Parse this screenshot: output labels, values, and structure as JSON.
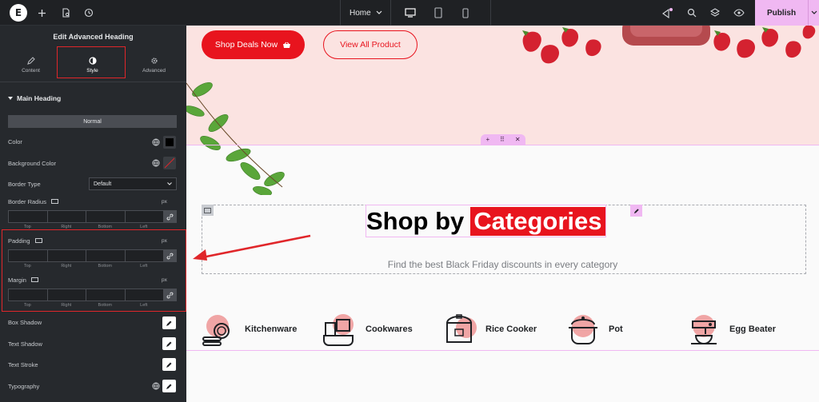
{
  "topbar": {
    "logo": "E",
    "home_label": "Home",
    "publish_label": "Publish"
  },
  "panel": {
    "title": "Edit Advanced Heading",
    "tabs": [
      {
        "label": "Content",
        "icon": "pencil-icon"
      },
      {
        "label": "Style",
        "icon": "contrast-icon"
      },
      {
        "label": "Advanced",
        "icon": "gear-icon"
      }
    ],
    "section_title": "Main Heading",
    "state_label": "Normal",
    "color_label": "Color",
    "bg_color_label": "Background Color",
    "border_type_label": "Border Type",
    "border_type_value": "Default",
    "border_radius_label": "Border Radius",
    "padding_label": "Padding",
    "margin_label": "Margin",
    "unit": "px",
    "dim_labels": [
      "Top",
      "Right",
      "Bottom",
      "Left"
    ],
    "box_shadow_label": "Box Shadow",
    "text_shadow_label": "Text Shadow",
    "text_stroke_label": "Text Stroke",
    "typography_label": "Typography"
  },
  "canvas": {
    "btn_deals": "Shop Deals Now",
    "btn_view": "View All Product",
    "heading_plain": "Shop by",
    "heading_highlight": "Categories",
    "subheading": "Find the best Black Friday discounts in every category",
    "categories": [
      "Kitchenware",
      "Cookwares",
      "Rice Cooker",
      "Pot",
      "Egg Beater"
    ]
  },
  "colors": {
    "accent_red": "#e8141e",
    "publish_pink": "#f0b8f2",
    "panel_bg": "#26292d"
  }
}
